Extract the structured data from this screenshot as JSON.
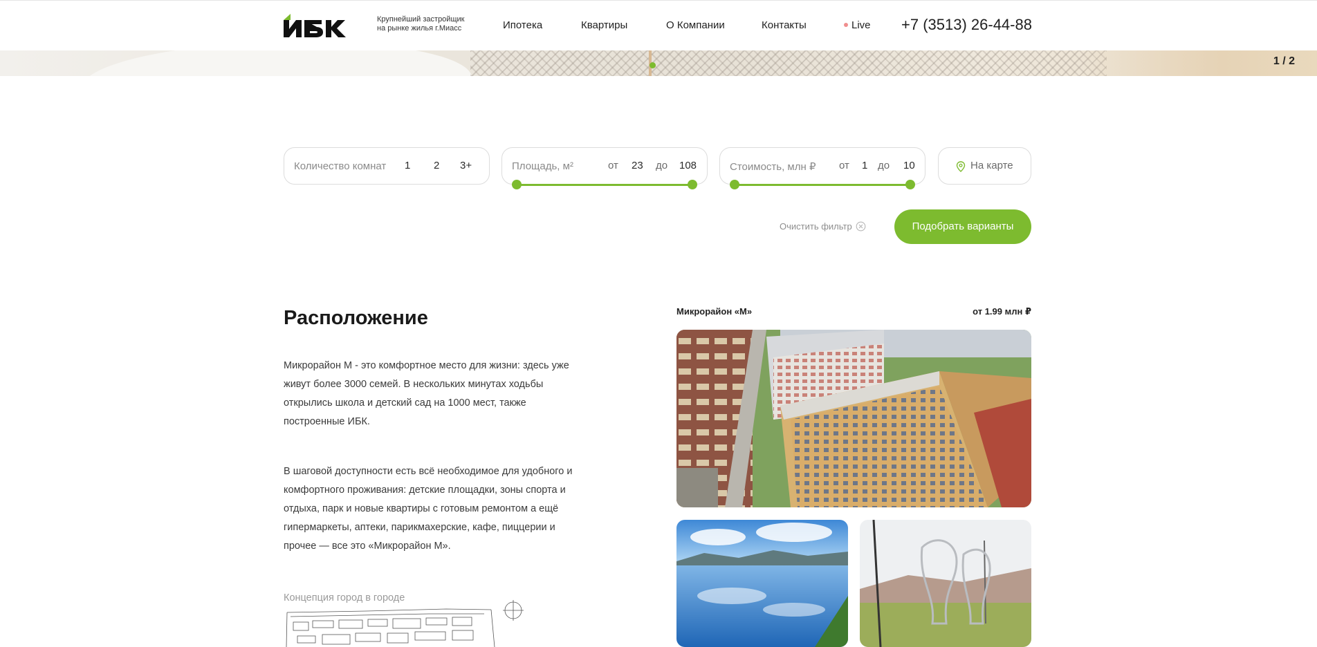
{
  "header": {
    "logo_text": "ИБК",
    "tagline_line1": "Крупнейший застройщик",
    "tagline_line2": "на рынке жилья г.Миасс",
    "nav": [
      "Ипотека",
      "Квартиры",
      "О Компании",
      "Контакты"
    ],
    "live": "Live",
    "phone": "+7 (3513) 26-44-88"
  },
  "hero": {
    "slide_counter": "1 / 2"
  },
  "filter": {
    "rooms": {
      "placeholder": "Количество комнат",
      "options": [
        "1",
        "2",
        "3+"
      ]
    },
    "area": {
      "placeholder": "Площадь, м²",
      "from_label": "от",
      "from": "23",
      "to_label": "до",
      "to": "108"
    },
    "price": {
      "placeholder": "Стоимость, млн ₽",
      "from_label": "от",
      "from": "1",
      "to_label": "до",
      "to": "10"
    },
    "map_button": "На карте",
    "clear": "Очистить фильтр",
    "submit": "Подобрать варианты"
  },
  "location": {
    "title": "Расположение",
    "paragraph1": "Микрорайон М - это комфортное место для жизни: здесь уже живут более 3000 семей. В нескольких минутах ходьбы открылись школа и детский сад на 1000 мест, также построенные ИБК.",
    "paragraph2": "В шаговой доступности есть всё необходимое для удобного и комфортного проживания: детские площадки, зоны спорта и отдыха, парк и новые квартиры с готовым ремонтом а ещё гипермаркеты, аптеки, парикмахерские, кафе, пиццерии и прочее — все это «Микрорайон М».",
    "concept": "Концепция город в городе"
  },
  "project_card": {
    "title": "Микрорайон «М»",
    "price": "от 1.99 млн ₽"
  },
  "colors": {
    "accent": "#7dbb2f",
    "live_dot": "#f08e8e",
    "text": "#1f1f1f"
  }
}
